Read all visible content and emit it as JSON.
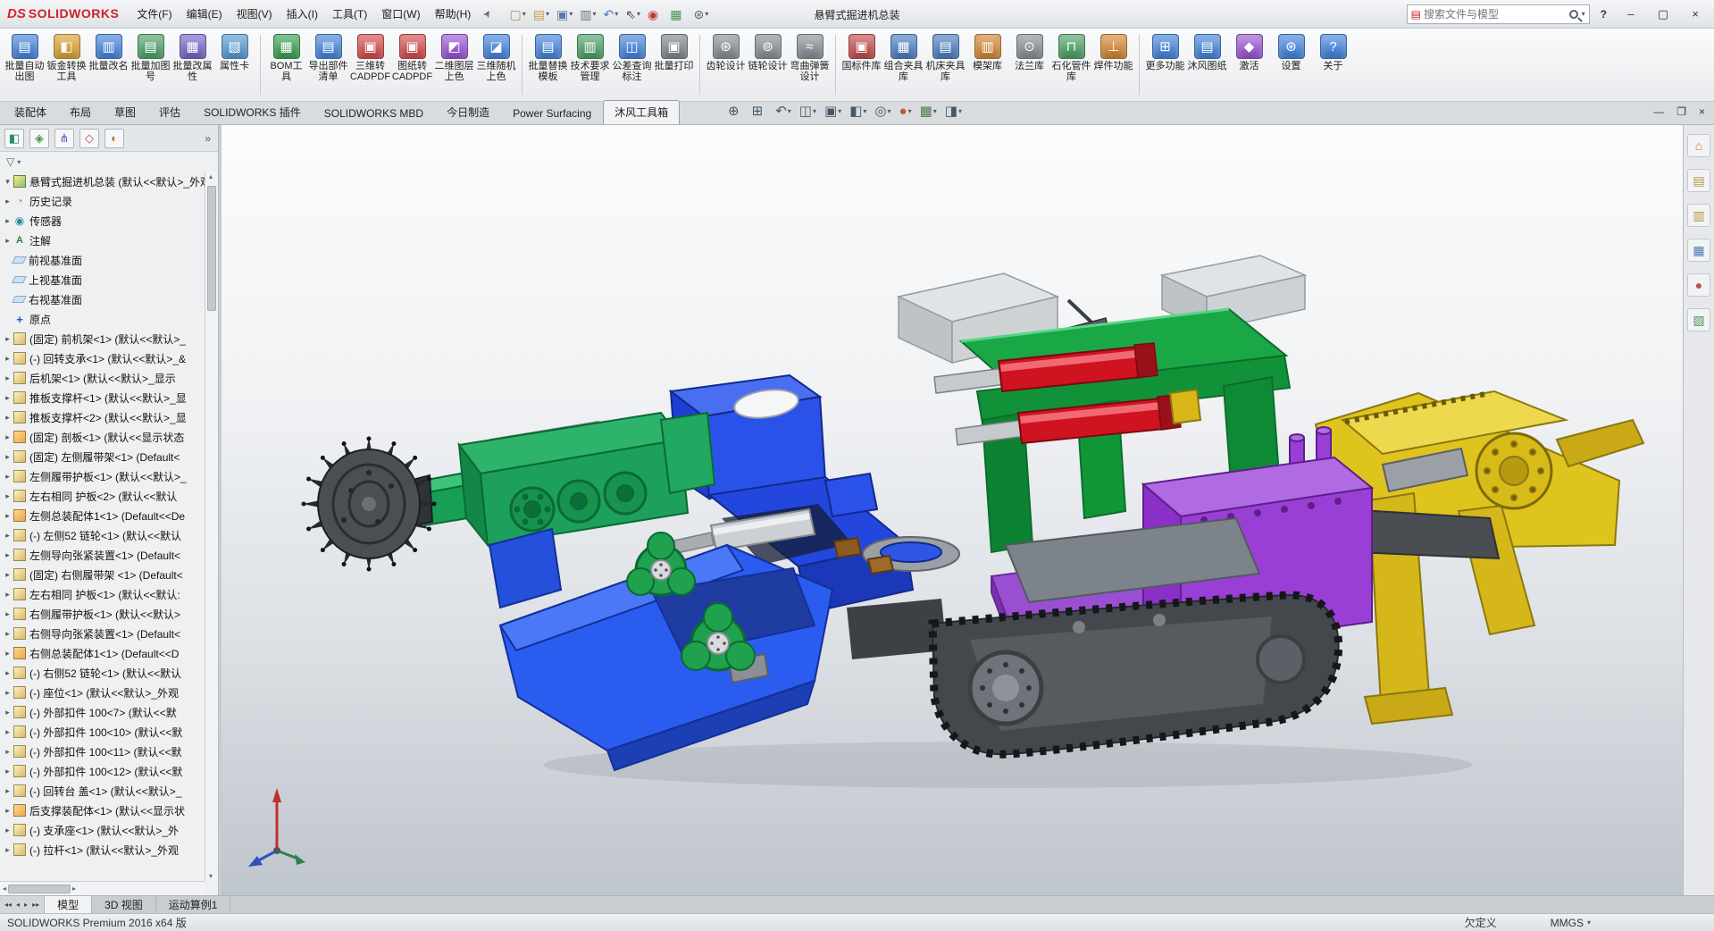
{
  "window": {
    "brand_mark": "DS",
    "brand_name": "SOLIDWORKS",
    "title": "悬臂式掘进机总装",
    "help_label": "?",
    "pin_glyph": "➤",
    "search": {
      "placeholder": "搜索文件与模型"
    }
  },
  "menubar": {
    "items": [
      {
        "label": "文件(F)"
      },
      {
        "label": "编辑(E)"
      },
      {
        "label": "视图(V)"
      },
      {
        "label": "插入(I)"
      },
      {
        "label": "工具(T)"
      },
      {
        "label": "窗口(W)"
      },
      {
        "label": "帮助(H)"
      }
    ]
  },
  "quick_access": {
    "items": [
      {
        "name": "new-document-button",
        "glyph": "▢",
        "color": "#b8933a",
        "caret": "caret"
      },
      {
        "name": "open-button",
        "glyph": "▤",
        "color": "#c8a040",
        "caret": "caret"
      },
      {
        "name": "save-button",
        "glyph": "▣",
        "color": "#5578b0",
        "caret": "caret"
      },
      {
        "name": "print-button",
        "glyph": "▥",
        "color": "#6a7078",
        "caret": "caret"
      },
      {
        "name": "undo-button",
        "glyph": "↶",
        "color": "#4a78c8",
        "caret": "caret"
      },
      {
        "name": "select-button",
        "glyph": "⇖",
        "color": "#444444",
        "caret": "caret"
      },
      {
        "name": "rebuild-button",
        "glyph": "◉",
        "color": "#c03838",
        "caret": "nocaret"
      },
      {
        "name": "file-properties-button",
        "glyph": "▦",
        "color": "#4a9058",
        "caret": "nocaret"
      },
      {
        "name": "options-button",
        "glyph": "⊛",
        "color": "#5a646e",
        "caret": "caret"
      }
    ]
  },
  "ribbon": {
    "groups": [
      {
        "items": [
          {
            "label": "批量自动出图",
            "glyph": "▤",
            "color": "#4a86d8"
          },
          {
            "label": "钣金转换工具",
            "glyph": "◧",
            "color": "#d8a23a"
          },
          {
            "label": "批量改名",
            "glyph": "▥",
            "color": "#4a86d8"
          },
          {
            "label": "批量加图号",
            "glyph": "▤",
            "color": "#52a06a"
          },
          {
            "label": "批量改属性",
            "glyph": "▦",
            "color": "#7a68c8"
          },
          {
            "label": "属性卡",
            "glyph": "▧",
            "color": "#5a9ad0"
          }
        ]
      },
      {
        "items": [
          {
            "label": "BOM工具",
            "glyph": "▦",
            "color": "#3f9f56"
          },
          {
            "label": "导出部件清单",
            "glyph": "▤",
            "color": "#4a86d8"
          },
          {
            "label": "三维转CADPDF等",
            "glyph": "▣",
            "color": "#d05050"
          },
          {
            "label": "图纸转CADPDF",
            "glyph": "▣",
            "color": "#d05050"
          },
          {
            "label": "二维图层上色",
            "glyph": "◩",
            "color": "#9a5ad0"
          },
          {
            "label": "三维随机上色",
            "glyph": "◪",
            "color": "#4a86d8"
          }
        ]
      },
      {
        "items": [
          {
            "label": "批量替换模板",
            "glyph": "▤",
            "color": "#4a86d8"
          },
          {
            "label": "技术要求管理",
            "glyph": "▥",
            "color": "#52a06a"
          },
          {
            "label": "公差查询标注",
            "glyph": "◫",
            "color": "#4a86d8"
          },
          {
            "label": "批量打印",
            "glyph": "▣",
            "color": "#808890"
          }
        ]
      },
      {
        "items": [
          {
            "label": "齿轮设计",
            "glyph": "⊛",
            "color": "#8a9098"
          },
          {
            "label": "链轮设计",
            "glyph": "⊚",
            "color": "#8a9098"
          },
          {
            "label": "弯曲弹簧设计",
            "glyph": "≈",
            "color": "#8a9098"
          }
        ]
      },
      {
        "items": [
          {
            "label": "国标件库",
            "glyph": "▣",
            "color": "#c05050"
          },
          {
            "label": "组合夹具库",
            "glyph": "▦",
            "color": "#5080c0"
          },
          {
            "label": "机床夹具库",
            "glyph": "▤",
            "color": "#5080c0"
          },
          {
            "label": "模架库",
            "glyph": "▥",
            "color": "#d0883a"
          },
          {
            "label": "法兰库",
            "glyph": "⊙",
            "color": "#8a9098"
          },
          {
            "label": "石化管件库",
            "glyph": "⊓",
            "color": "#52a06a"
          },
          {
            "label": "焊件功能",
            "glyph": "⊥",
            "color": "#d0883a"
          }
        ]
      },
      {
        "items": [
          {
            "label": "更多功能",
            "glyph": "⊞",
            "color": "#4a86d8"
          },
          {
            "label": "沐风图纸",
            "glyph": "▤",
            "color": "#4a86d8"
          },
          {
            "label": "激活",
            "glyph": "◆",
            "color": "#9a5ad0"
          },
          {
            "label": "设置",
            "glyph": "⊛",
            "color": "#4a86d8"
          },
          {
            "label": "关于",
            "glyph": "?",
            "color": "#4a86d8"
          }
        ]
      }
    ]
  },
  "commandmanager": {
    "tabs": [
      {
        "label": "装配体",
        "state": "inactive"
      },
      {
        "label": "布局",
        "state": "inactive"
      },
      {
        "label": "草图",
        "state": "inactive"
      },
      {
        "label": "评估",
        "state": "inactive"
      },
      {
        "label": "SOLIDWORKS 插件",
        "state": "inactive"
      },
      {
        "label": "SOLIDWORKS MBD",
        "state": "inactive"
      },
      {
        "label": "今日制造",
        "state": "inactive"
      },
      {
        "label": "Power Surfacing",
        "state": "inactive"
      },
      {
        "label": "沐风工具箱",
        "state": "active"
      }
    ]
  },
  "hud": {
    "items": [
      {
        "name": "zoom-fit-button",
        "glyph": "⊕",
        "color": "#46566a",
        "caret": "nocaret"
      },
      {
        "name": "zoom-area-button",
        "glyph": "⊞",
        "color": "#46566a",
        "caret": "nocaret"
      },
      {
        "name": "previous-view-button",
        "glyph": "↶",
        "color": "#46566a",
        "caret": "caret"
      },
      {
        "name": "section-view-button",
        "glyph": "◫",
        "color": "#46566a",
        "caret": "caret"
      },
      {
        "name": "view-orientation-button",
        "glyph": "▣",
        "color": "#46566a",
        "caret": "caret"
      },
      {
        "name": "display-style-button",
        "glyph": "◧",
        "color": "#46566a",
        "caret": "caret"
      },
      {
        "name": "hide-show-items-button",
        "glyph": "◎",
        "color": "#46566a",
        "caret": "caret"
      },
      {
        "name": "edit-appearance-button",
        "glyph": "●",
        "color": "#c2563a",
        "caret": "caret"
      },
      {
        "name": "apply-scene-button",
        "glyph": "▦",
        "color": "#4a7a4a",
        "caret": "caret"
      },
      {
        "name": "view-settings-button",
        "glyph": "◨",
        "color": "#46566a",
        "caret": "caret"
      }
    ]
  },
  "doc_window_controls": {
    "items": [
      {
        "name": "doc-minimize-button",
        "glyph": "—"
      },
      {
        "name": "doc-restore-button",
        "glyph": "❐"
      },
      {
        "name": "doc-close-button",
        "glyph": "×"
      }
    ]
  },
  "feature_panel": {
    "tabs": [
      {
        "name": "featuremanager-tab",
        "glyph": "◧",
        "color": "#2a8a6a"
      },
      {
        "name": "propertymanager-tab",
        "glyph": "◈",
        "color": "#3a9a4a"
      },
      {
        "name": "configurationmanager-tab",
        "glyph": "⋔",
        "color": "#6a4ac0"
      },
      {
        "name": "dimxpertmanager-tab",
        "glyph": "◇",
        "color": "#c04848"
      },
      {
        "name": "displaymanager-tab",
        "glyph": "◐",
        "color": "#c07828"
      }
    ],
    "flyout_arrow": "»",
    "filter_glyph": "▽",
    "tree": {
      "items": [
        {
          "label": "悬臂式掘进机总装 (默认<<默认>_外观",
          "icon": "ic-asm",
          "exp": "expdown"
        },
        {
          "label": "历史记录",
          "icon": "ic-hist",
          "exp": "exp"
        },
        {
          "label": "传感器",
          "icon": "ic-sensor",
          "exp": "exp"
        },
        {
          "label": "注解",
          "icon": "ic-note",
          "exp": "exp"
        },
        {
          "label": "前视基准面",
          "icon": "ic-plane",
          "exp": "noexp"
        },
        {
          "label": "上视基准面",
          "icon": "ic-plane",
          "exp": "noexp"
        },
        {
          "label": "右视基准面",
          "icon": "ic-plane",
          "exp": "noexp"
        },
        {
          "label": "原点",
          "icon": "ic-origin",
          "exp": "noexp"
        },
        {
          "label": "(固定) 前机架<1> (默认<<默认>_",
          "icon": "ic-part",
          "exp": "exp"
        },
        {
          "label": "(-) 回转支承<1> (默认<<默认>_&",
          "icon": "ic-part",
          "exp": "exp"
        },
        {
          "label": "后机架<1> (默认<<默认>_显示",
          "icon": "ic-part",
          "exp": "exp"
        },
        {
          "label": "推板支撑杆<1> (默认<<默认>_显",
          "icon": "ic-part",
          "exp": "exp"
        },
        {
          "label": "推板支撑杆<2> (默认<<默认>_显",
          "icon": "ic-part",
          "exp": "exp"
        },
        {
          "label": "(固定) 剖板<1> (默认<<显示状态",
          "icon": "ic-subasm",
          "exp": "exp"
        },
        {
          "label": "(固定) 左侧履带架<1> (Default<",
          "icon": "ic-part",
          "exp": "exp"
        },
        {
          "label": "左侧履带护板<1> (默认<<默认>_",
          "icon": "ic-part",
          "exp": "exp"
        },
        {
          "label": "左右相同 护板<2> (默认<<默认",
          "icon": "ic-part",
          "exp": "exp"
        },
        {
          "label": "左侧总装配体1<1> (Default<<De",
          "icon": "ic-subasm",
          "exp": "exp"
        },
        {
          "label": "(-) 左侧52 链轮<1> (默认<<默认",
          "icon": "ic-part",
          "exp": "exp"
        },
        {
          "label": "左侧导向张紧装置<1> (Default<",
          "icon": "ic-part",
          "exp": "exp"
        },
        {
          "label": "(固定) 右侧履带架 <1> (Default<",
          "icon": "ic-part",
          "exp": "exp"
        },
        {
          "label": "左右相同 护板<1> (默认<<默认:",
          "icon": "ic-part",
          "exp": "exp"
        },
        {
          "label": "右侧履带护板<1> (默认<<默认>",
          "icon": "ic-part",
          "exp": "exp"
        },
        {
          "label": "右侧导向张紧装置<1> (Default<",
          "icon": "ic-part",
          "exp": "exp"
        },
        {
          "label": "右侧总装配体1<1> (Default<<D",
          "icon": "ic-subasm",
          "exp": "exp"
        },
        {
          "label": "(-) 右侧52 链轮<1> (默认<<默认",
          "icon": "ic-part",
          "exp": "exp"
        },
        {
          "label": "(-) 座位<1> (默认<<默认>_外观",
          "icon": "ic-part",
          "exp": "exp"
        },
        {
          "label": "(-) 外部扣件 100<7> (默认<<默",
          "icon": "ic-part",
          "exp": "exp"
        },
        {
          "label": "(-) 外部扣件 100<10> (默认<<默",
          "icon": "ic-part",
          "exp": "exp"
        },
        {
          "label": "(-) 外部扣件 100<11> (默认<<默",
          "icon": "ic-part",
          "exp": "exp"
        },
        {
          "label": "(-) 外部扣件 100<12> (默认<<默",
          "icon": "ic-part",
          "exp": "exp"
        },
        {
          "label": "(-) 回转台 盖<1> (默认<<默认>_",
          "icon": "ic-part",
          "exp": "exp"
        },
        {
          "label": "后支撑装配体<1> (默认<<显示状",
          "icon": "ic-subasm",
          "exp": "exp"
        },
        {
          "label": "(-) 支承座<1> (默认<<默认>_外",
          "icon": "ic-part",
          "exp": "exp"
        },
        {
          "label": "(-) 拉杆<1> (默认<<默认>_外观",
          "icon": "ic-part",
          "exp": "exp"
        }
      ]
    }
  },
  "viewport": {
    "part_colors": {
      "cutting_head": "#4a4f54",
      "boom_gearbox": "#1da05c",
      "turret": "#2a52e8",
      "shovel": "#2a5cf0",
      "frame": "#1aa746",
      "cylinders": "#cf1320",
      "tank": "#9a3fd6",
      "track": "#44484d",
      "rear_frame": "#e0c41e",
      "boxes": "#d8dcde"
    }
  },
  "taskpane": {
    "items": [
      {
        "name": "solidworks-resources-tab",
        "glyph": "⌂",
        "color": "#c87828"
      },
      {
        "name": "design-library-tab",
        "glyph": "▤",
        "color": "#b8943a"
      },
      {
        "name": "file-explorer-tab",
        "glyph": "▥",
        "color": "#b8943a"
      },
      {
        "name": "view-palette-tab",
        "glyph": "▦",
        "color": "#4a78b8"
      },
      {
        "name": "appearances-tab",
        "glyph": "●",
        "color": "#c05050"
      },
      {
        "name": "custom-properties-tab",
        "glyph": "▧",
        "color": "#4a9058"
      }
    ]
  },
  "doc_tabs": {
    "nav": [
      {
        "name": "first-tab-button",
        "glyph": "◂◂"
      },
      {
        "name": "prev-tab-button",
        "glyph": "◂"
      },
      {
        "name": "next-tab-button",
        "glyph": "▸"
      },
      {
        "name": "last-tab-button",
        "glyph": "▸▸"
      }
    ],
    "tabs": [
      {
        "label": "模型",
        "state": "active"
      },
      {
        "label": "3D 视图",
        "state": "inactive"
      },
      {
        "label": "运动算例1",
        "state": "inactive"
      }
    ]
  },
  "statusbar": {
    "left": "SOLIDWORKS Premium 2016 x64 版",
    "definition_status": "欠定义",
    "units": "MMGS",
    "units_caret": "▾"
  }
}
